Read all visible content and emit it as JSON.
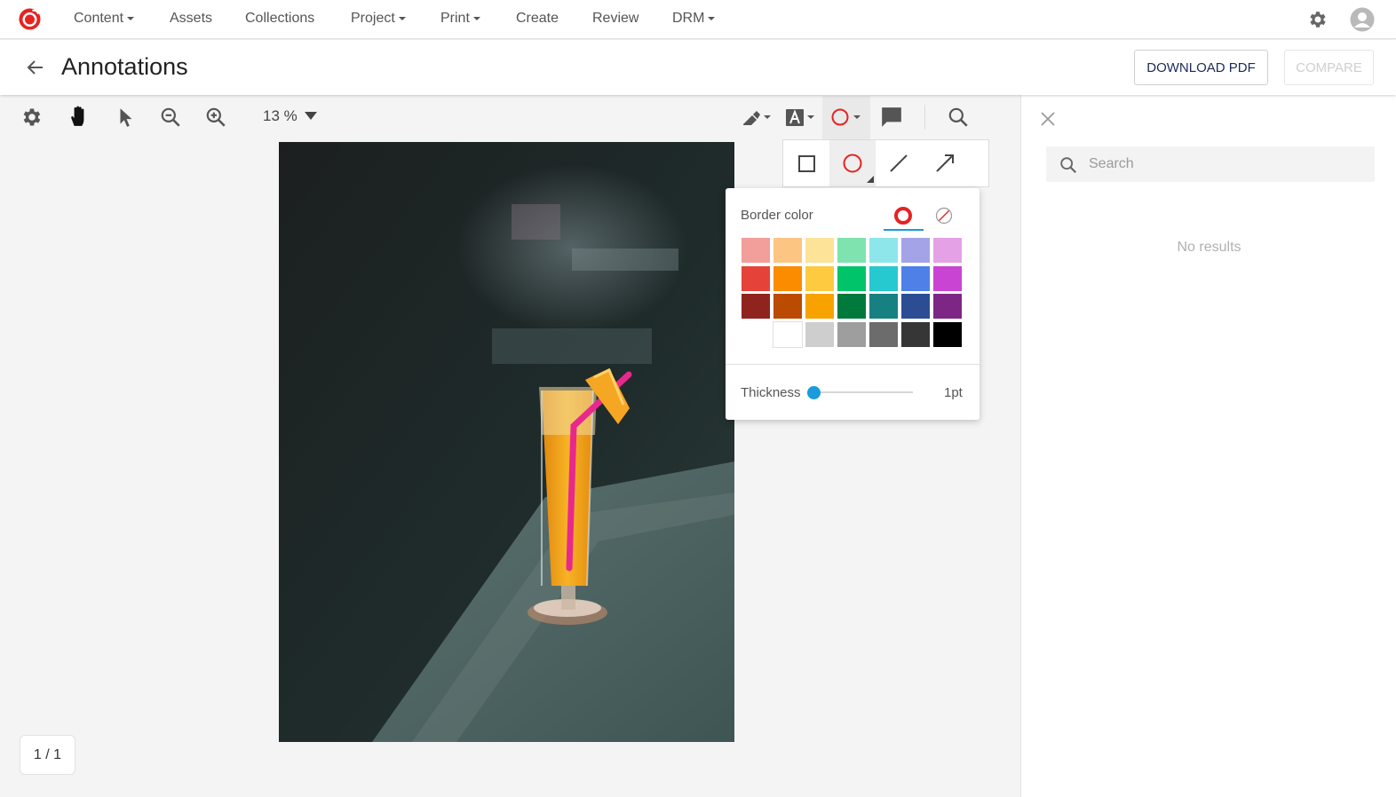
{
  "nav": {
    "logo_icon": "brand-logo",
    "items": [
      {
        "label": "Content",
        "dropdown": true
      },
      {
        "label": "Assets",
        "dropdown": false
      },
      {
        "label": "Collections",
        "dropdown": false
      },
      {
        "label": "Project",
        "dropdown": true
      },
      {
        "label": "Print",
        "dropdown": true
      },
      {
        "label": "Create",
        "dropdown": false
      },
      {
        "label": "Review",
        "dropdown": false
      },
      {
        "label": "DRM",
        "dropdown": true
      }
    ],
    "settings_icon": "gear-icon",
    "user_icon": "user-avatar-icon"
  },
  "header": {
    "title": "Annotations",
    "download_label": "DOWNLOAD PDF",
    "compare_label": "COMPARE"
  },
  "toolbar": {
    "zoom": "13 %",
    "tools": [
      "settings",
      "pan",
      "select",
      "zoom-out",
      "zoom-in",
      "highlight",
      "text",
      "shape",
      "comment",
      "search"
    ]
  },
  "shape_picker": {
    "options": [
      "rectangle",
      "ellipse",
      "line",
      "arrow"
    ],
    "selected": "ellipse"
  },
  "border_color": {
    "label": "Border color",
    "selected_color": "#e52222",
    "palette": [
      [
        "#f29e9a",
        "#fdc582",
        "#fde398",
        "#7fe3af",
        "#8fe6ea",
        "#a4a3e8",
        "#e5a1e6"
      ],
      [
        "#e5433a",
        "#fb8c00",
        "#fdca40",
        "#00c46a",
        "#25c9cf",
        "#4f80e8",
        "#c944d3"
      ],
      [
        "#8f241f",
        "#bb4b00",
        "#f8a200",
        "#007a3c",
        "#178181",
        "#2c4d94",
        "#7d2685"
      ],
      [
        "transparent",
        "#ffffff",
        "#cecece",
        "#9e9e9e",
        "#6c6c6c",
        "#363636",
        "#000000"
      ]
    ]
  },
  "thickness": {
    "label": "Thickness",
    "value": "1pt",
    "fraction": 0.0
  },
  "pagination": {
    "label": "1 / 1"
  },
  "side_panel": {
    "search_placeholder": "Search",
    "empty_label": "No results"
  }
}
